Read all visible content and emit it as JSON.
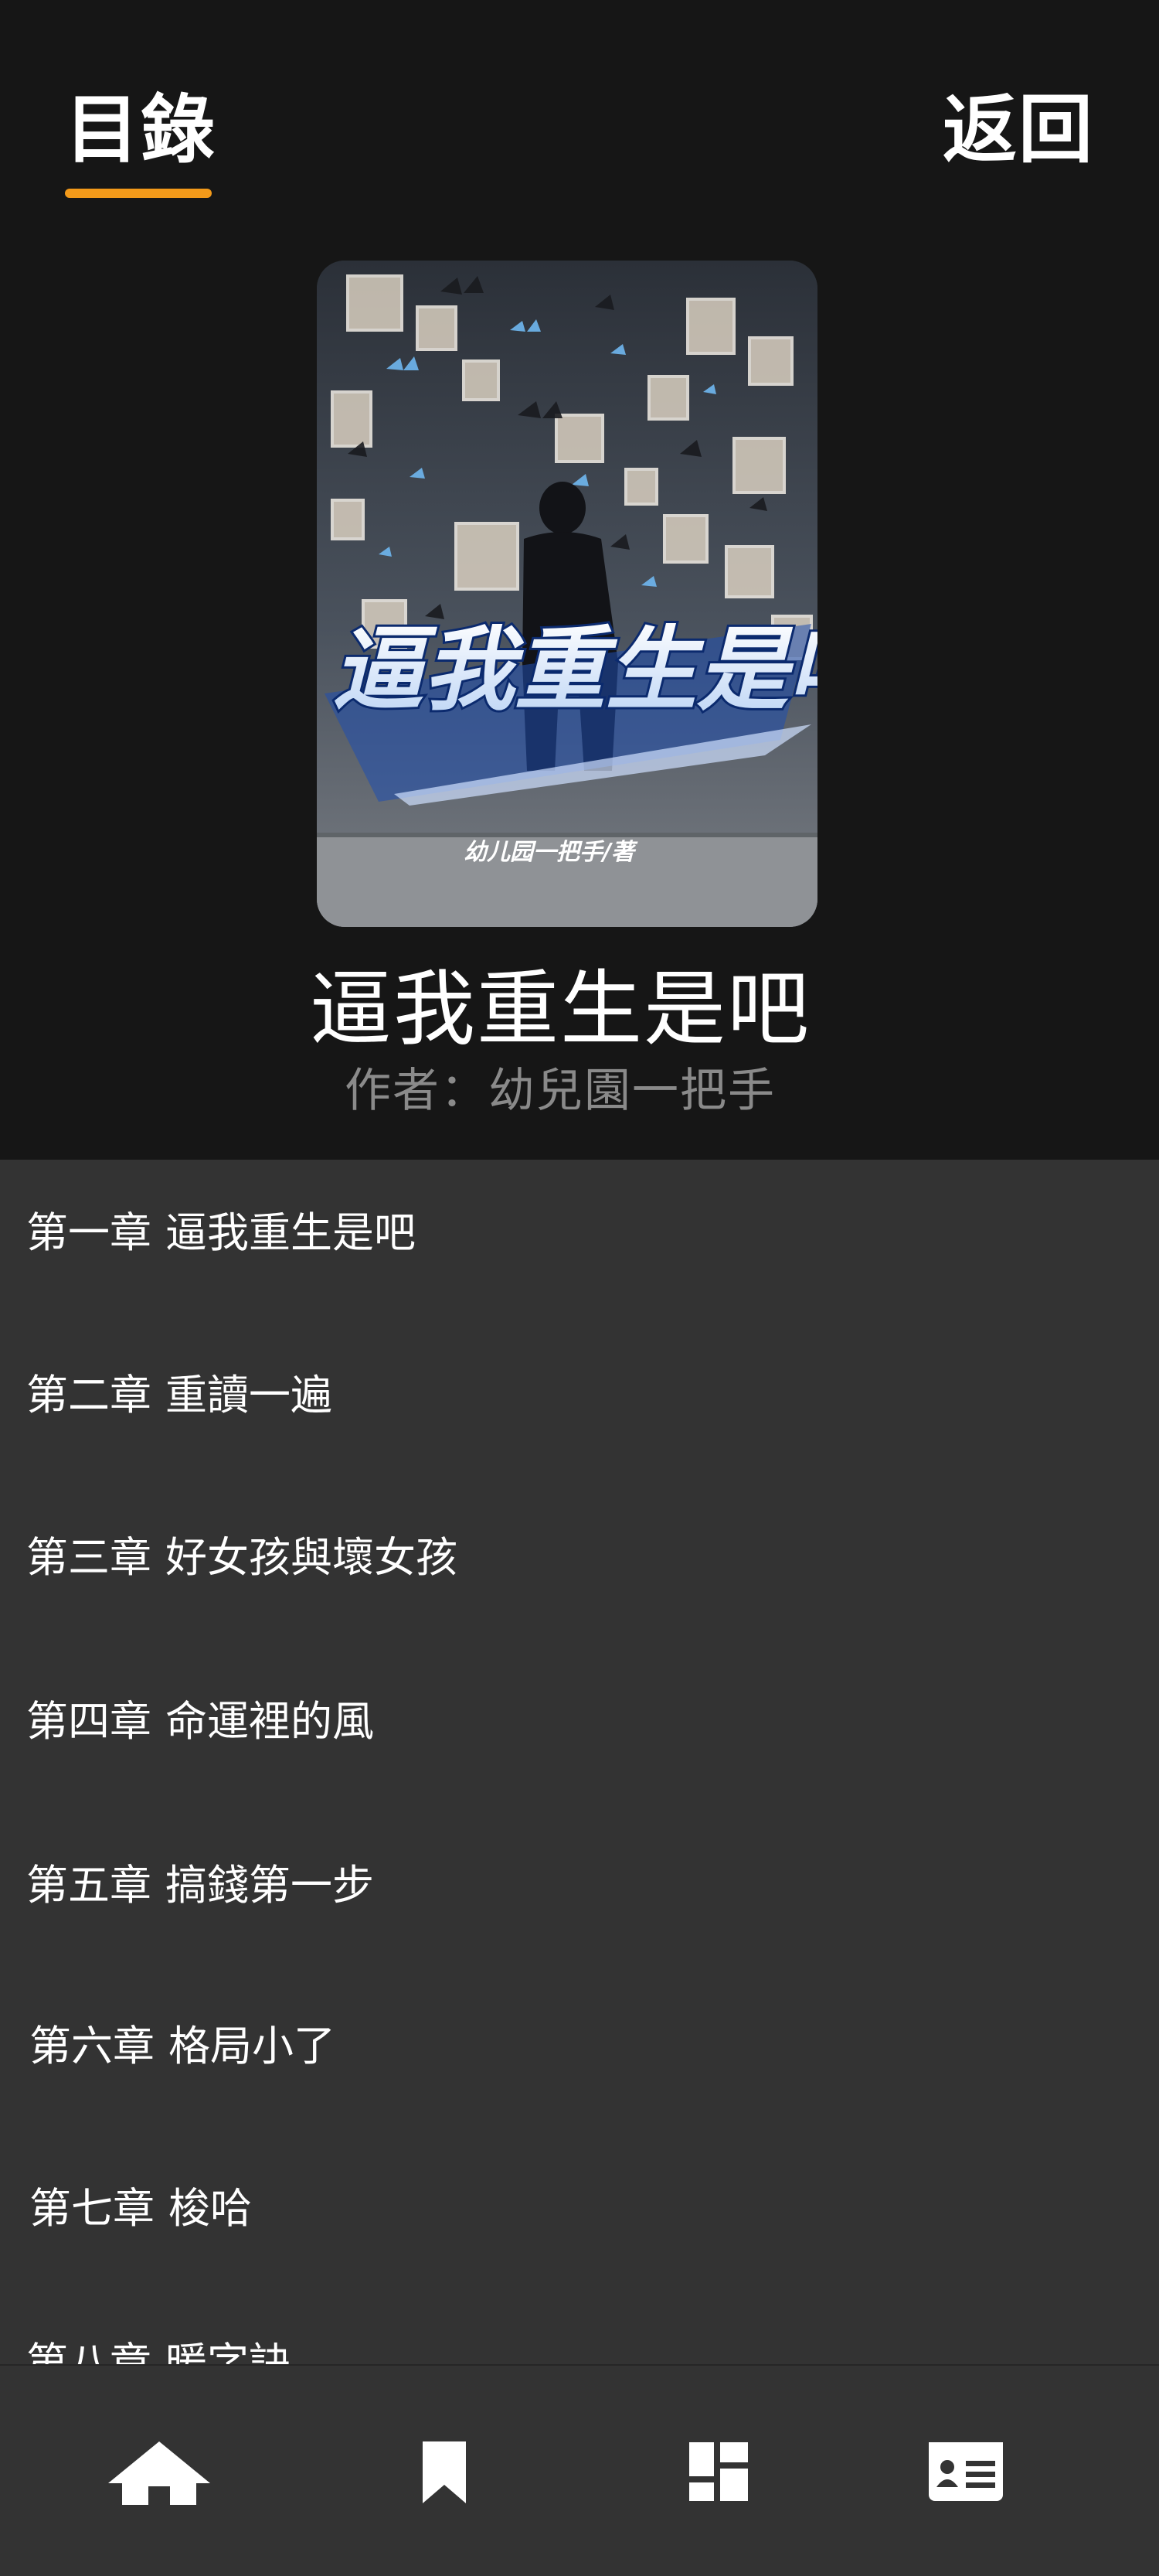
{
  "header": {
    "toc_label": "目錄",
    "back_label": "返回",
    "accent_color": "#f39a1a"
  },
  "book": {
    "title": "逼我重生是吧",
    "author_line": "作者：幼兒園一把手",
    "cover": {
      "title_art": "逼我重生是吧",
      "author_art": "幼儿园一把手/著"
    }
  },
  "chapters": [
    {
      "num": "第一章",
      "title": "逼我重生是吧"
    },
    {
      "num": "第二章",
      "title": "重讀一遍"
    },
    {
      "num": "第三章",
      "title": "好女孩與壞女孩"
    },
    {
      "num": "第四章",
      "title": "命運裡的風"
    },
    {
      "num": "第五章",
      "title": "搞錢第一步"
    },
    {
      "num": "第六章",
      "title": "格局小了"
    },
    {
      "num": "第七章",
      "title": "梭哈"
    },
    {
      "num": "第八章",
      "title": "暖字訣"
    }
  ],
  "bottom_nav": [
    {
      "icon": "home-icon"
    },
    {
      "icon": "bookmark-icon"
    },
    {
      "icon": "dashboard-icon"
    },
    {
      "icon": "profile-card-icon"
    }
  ]
}
